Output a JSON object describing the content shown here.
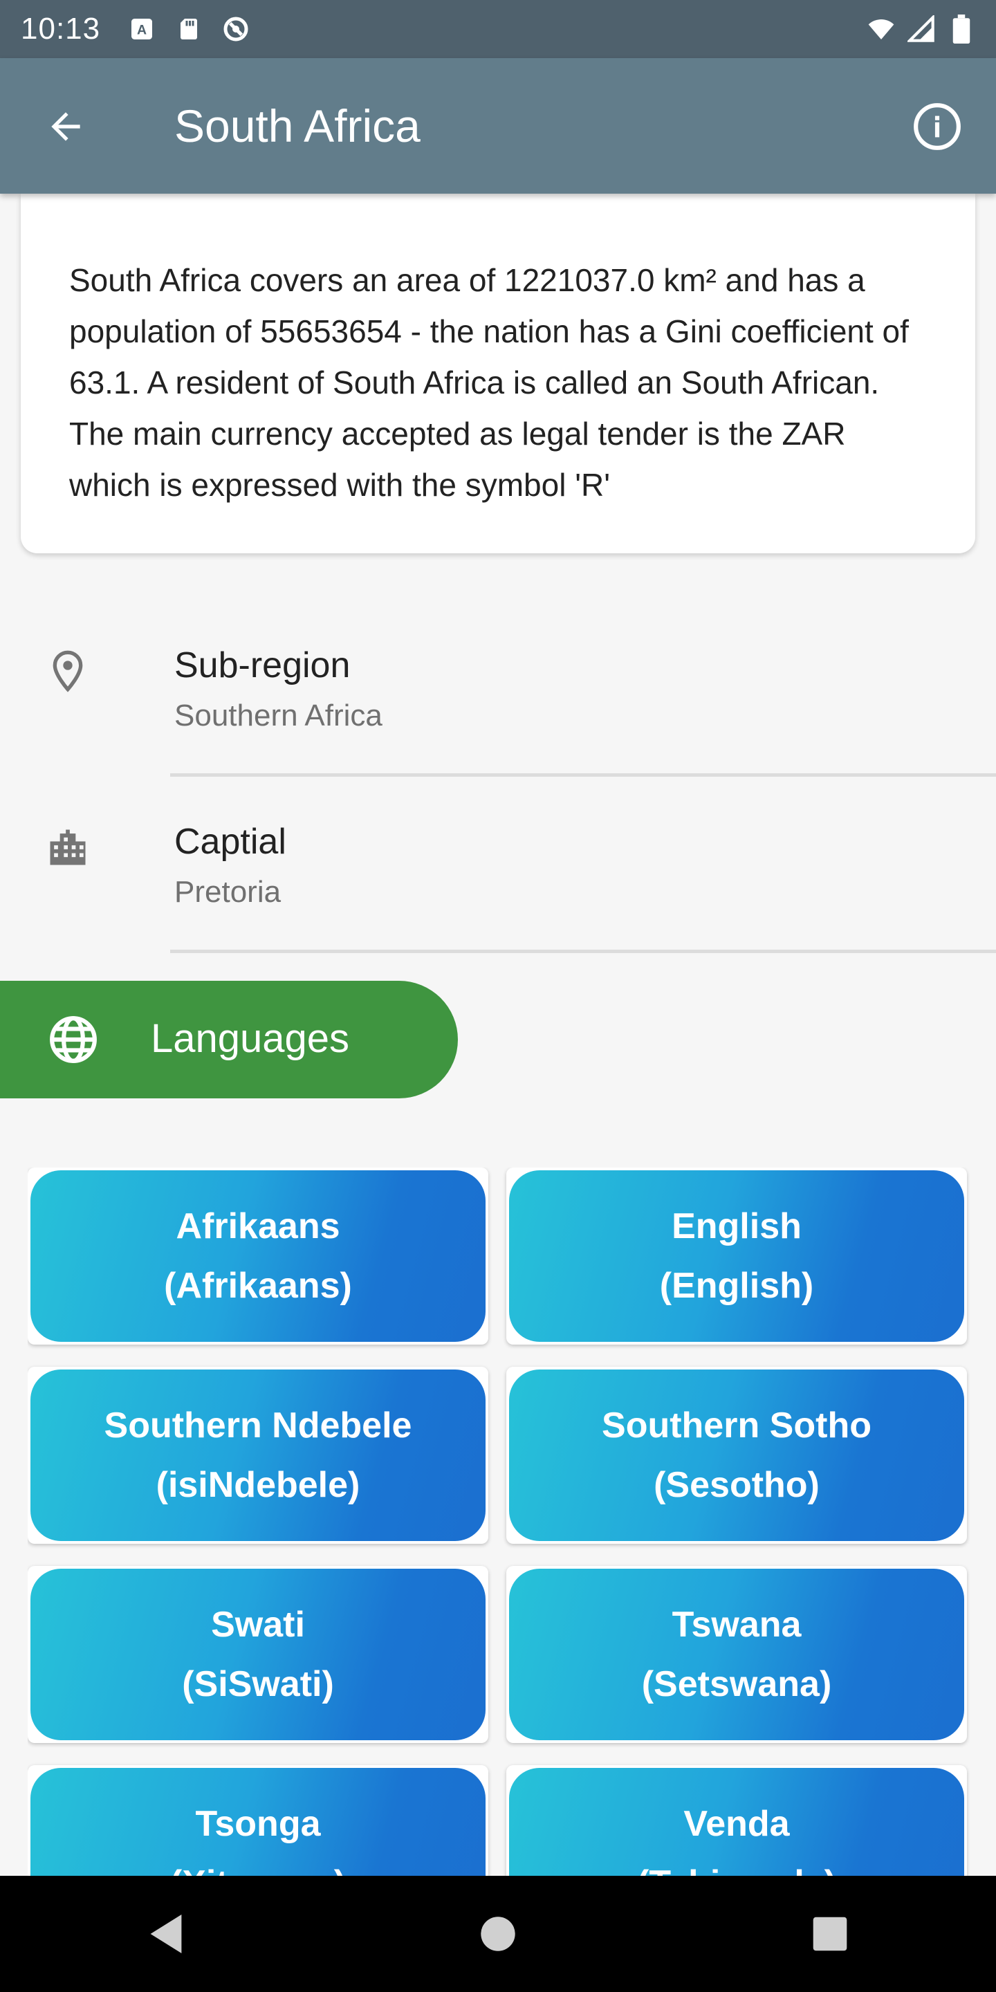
{
  "status_bar": {
    "time": "10:13",
    "icons": [
      "a-square-icon",
      "sd-card-icon",
      "do-not-disturb-icon",
      "wifi-icon",
      "signal-icon",
      "battery-icon"
    ]
  },
  "app_bar": {
    "title": "South Africa",
    "background": "#627d8b"
  },
  "description": "South Africa covers an area of 1221037.0 km² and has a population of 55653654 - the nation has a Gini coefficient of 63.1. A resident of South Africa is called an South African. The main currency accepted as legal tender is the ZAR which is expressed with the symbol 'R'",
  "info": {
    "subregion": {
      "title": "Sub-region",
      "value": "Southern Africa",
      "icon": "location-pin-icon"
    },
    "capital": {
      "title": "Captial",
      "value": "Pretoria",
      "icon": "building-icon"
    }
  },
  "languages_header": {
    "label": "Languages",
    "icon": "globe-icon",
    "color": "#3f9540"
  },
  "languages": [
    {
      "name": "Afrikaans",
      "native": "(Afrikaans)"
    },
    {
      "name": "English",
      "native": "(English)"
    },
    {
      "name": "Southern Ndebele",
      "native": "(isiNdebele)"
    },
    {
      "name": "Southern Sotho",
      "native": "(Sesotho)"
    },
    {
      "name": "Swati",
      "native": "(SiSwati)"
    },
    {
      "name": "Tswana",
      "native": "(Setswana)"
    },
    {
      "name": "Tsonga",
      "native": "(Xitsonga)"
    },
    {
      "name": "Venda",
      "native": "(Tshivenda)"
    }
  ],
  "nav_bar": {
    "buttons": [
      "back-triangle-icon",
      "home-circle-icon",
      "recents-square-icon"
    ]
  }
}
